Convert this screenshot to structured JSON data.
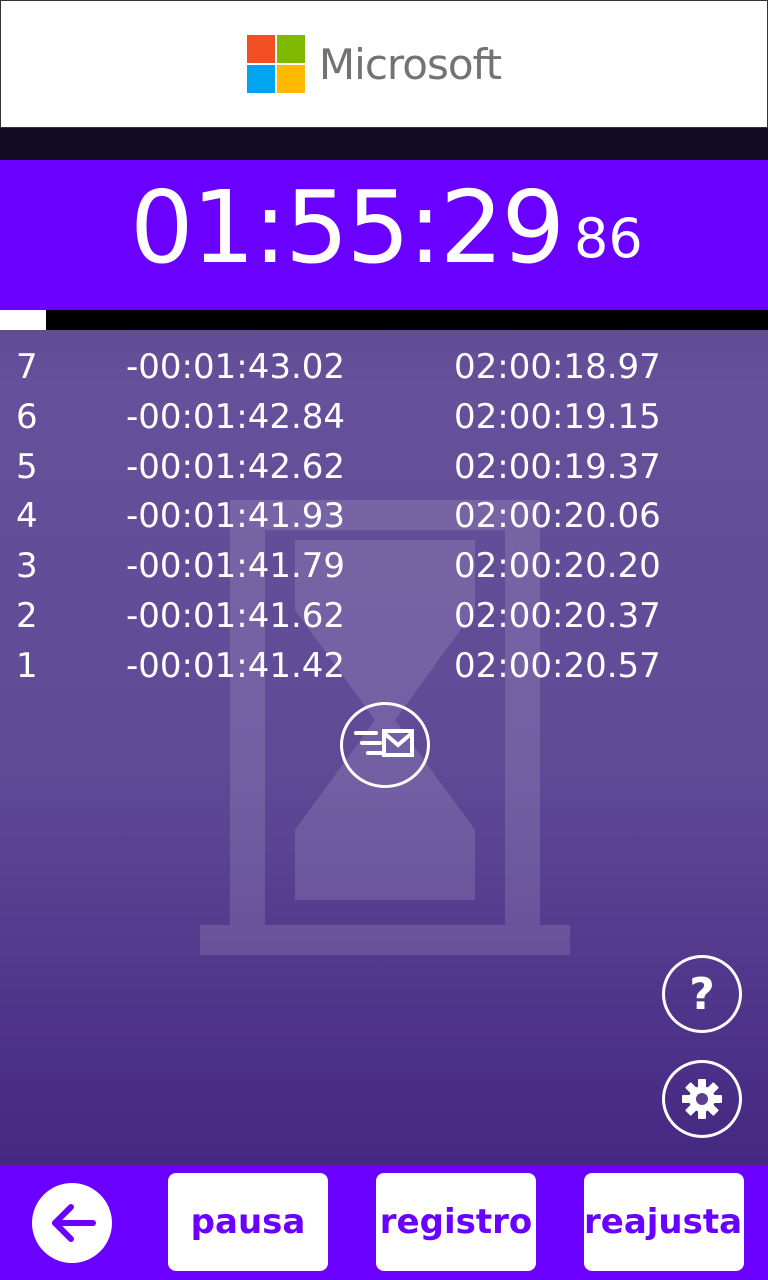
{
  "ad": {
    "brand": "Microsoft",
    "colors": [
      "#f25022",
      "#7fba00",
      "#00a4ef",
      "#ffb900"
    ]
  },
  "timer": {
    "main": "01:55:29",
    "hundredths": "86",
    "progress": 0.06
  },
  "laps": [
    {
      "num": "7",
      "diff": "-00:01:43.02",
      "total": "02:00:18.97"
    },
    {
      "num": "6",
      "diff": "-00:01:42.84",
      "total": "02:00:19.15"
    },
    {
      "num": "5",
      "diff": "-00:01:42.62",
      "total": "02:00:19.37"
    },
    {
      "num": "4",
      "diff": "-00:01:41.93",
      "total": "02:00:20.06"
    },
    {
      "num": "3",
      "diff": "-00:01:41.79",
      "total": "02:00:20.20"
    },
    {
      "num": "2",
      "diff": "-00:01:41.62",
      "total": "02:00:20.37"
    },
    {
      "num": "1",
      "diff": "-00:01:41.42",
      "total": "02:00:20.57"
    }
  ],
  "buttons": {
    "help_label": "?",
    "pause_label": "pausa",
    "log_label": "registro",
    "reset_label": "reajustar"
  },
  "icons": {
    "send": "send-mail-icon",
    "help": "help-icon",
    "settings": "gear-icon",
    "back": "arrow-left-icon"
  },
  "theme": {
    "accent": "#6a00ff"
  }
}
